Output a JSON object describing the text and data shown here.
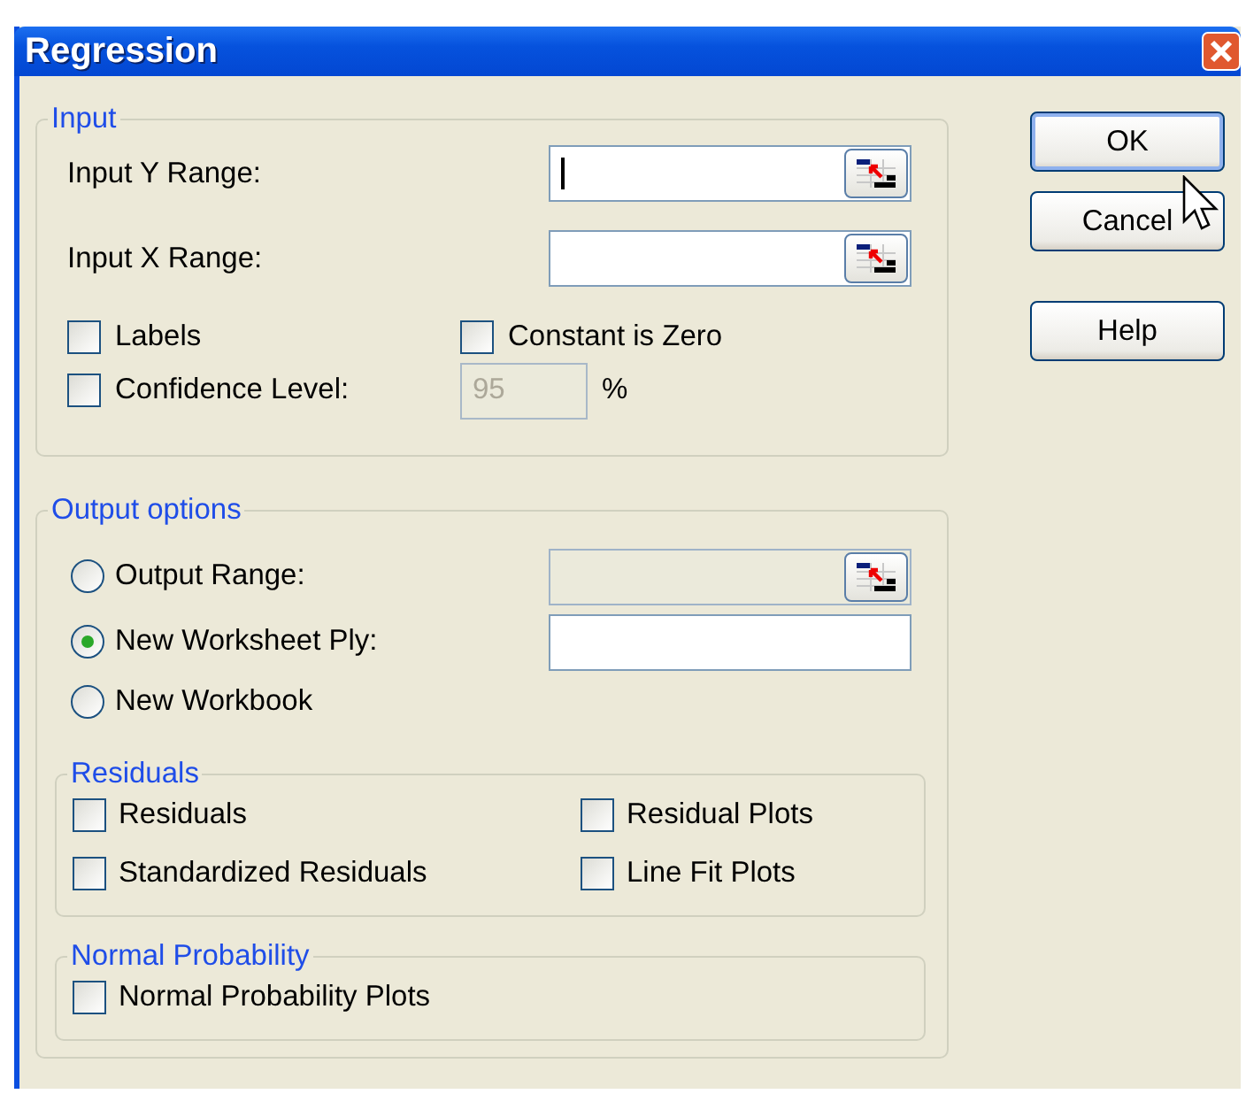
{
  "window": {
    "title": "Regression"
  },
  "input": {
    "title": "Input",
    "ranges": [
      {
        "label": "Input Y Range:",
        "focused": true
      },
      {
        "label": "Input X Range:",
        "focused": false
      }
    ],
    "labels": {
      "label": "Labels",
      "checked": false
    },
    "constant_is_zero": {
      "label": "Constant is Zero",
      "checked": false
    },
    "confidence_level": {
      "label": "Confidence Level:",
      "checked": false,
      "value": "95",
      "disabled": true,
      "unit": "%"
    }
  },
  "output_options": {
    "title": "Output options",
    "choices": [
      {
        "label": "Output Range:",
        "selected": false,
        "kind": "range",
        "disabled": true
      },
      {
        "label": "New Worksheet Ply:",
        "selected": true,
        "kind": "text",
        "disabled": false
      },
      {
        "label": "New Workbook",
        "selected": false,
        "kind": "plain"
      }
    ],
    "residuals": {
      "title": "Residuals",
      "items": [
        {
          "label": "Residuals",
          "checked": false
        },
        {
          "label": "Residual Plots",
          "checked": false
        },
        {
          "label": "Standardized Residuals",
          "checked": false
        },
        {
          "label": "Line Fit Plots",
          "checked": false
        }
      ]
    },
    "normal_probability": {
      "title": "Normal Probability",
      "items": [
        {
          "label": "Normal Probability Plots",
          "checked": false
        }
      ]
    }
  },
  "buttons": [
    {
      "label": "OK",
      "default": true
    },
    {
      "label": "Cancel",
      "default": false
    },
    {
      "label": "Help",
      "default": false
    }
  ]
}
